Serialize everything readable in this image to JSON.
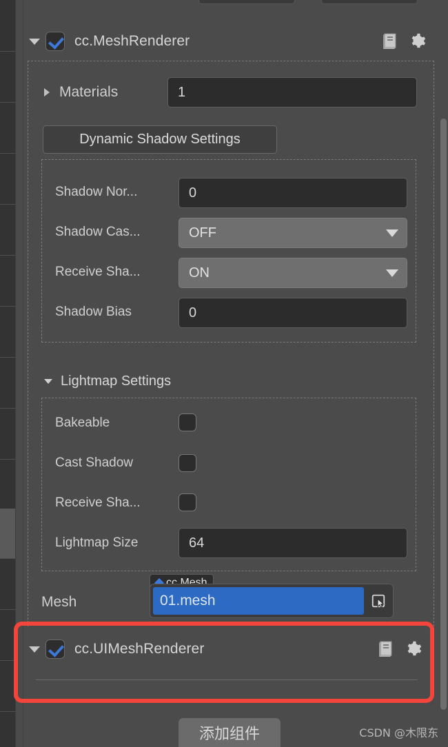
{
  "panel": {
    "mesh_renderer": {
      "title": "cc.MeshRenderer",
      "enabled_checkbox": "checked",
      "expanded": true,
      "icons": {
        "book": "book-icon",
        "gear": "gear-icon"
      },
      "materials": {
        "label": "Materials",
        "value": "1"
      },
      "dynamic_shadow_settings": {
        "button_label": "Dynamic Shadow Settings",
        "rows": [
          {
            "label": "Shadow Nor...",
            "type": "number",
            "value": "0"
          },
          {
            "label": "Shadow Cas...",
            "type": "dropdown",
            "value": "OFF"
          },
          {
            "label": "Receive Sha...",
            "type": "dropdown",
            "value": "ON"
          },
          {
            "label": "Shadow Bias",
            "type": "number",
            "value": "0"
          }
        ]
      },
      "lightmap_settings": {
        "title": "Lightmap Settings",
        "expanded": true,
        "rows": [
          {
            "label": "Bakeable",
            "type": "checkbox",
            "value": "unchecked"
          },
          {
            "label": "Cast Shadow",
            "type": "checkbox",
            "value": "unchecked"
          },
          {
            "label": "Receive Sha...",
            "type": "checkbox",
            "value": "unchecked"
          },
          {
            "label": "Lightmap Size",
            "type": "number",
            "value": "64"
          }
        ]
      },
      "mesh": {
        "label": "Mesh",
        "value": "01.mesh",
        "tooltip_type": "cc.Mesh"
      }
    },
    "ui_mesh_renderer": {
      "title": "cc.UIMeshRenderer",
      "enabled_checkbox": "checked",
      "expanded": true,
      "icons": {
        "book": "book-icon",
        "gear": "gear-icon"
      }
    },
    "add_component_button": "添加组件"
  },
  "watermark": "CSDN @木限东",
  "colors": {
    "panel_bg": "#4b4b4b",
    "field_bg": "#2c2c2c",
    "dropdown_bg": "#6f6f6f",
    "accent_blue": "#3c78d8",
    "selection_blue": "#2d6ac4",
    "highlight_red": "#f4453c",
    "text": "#d6d6d6"
  }
}
